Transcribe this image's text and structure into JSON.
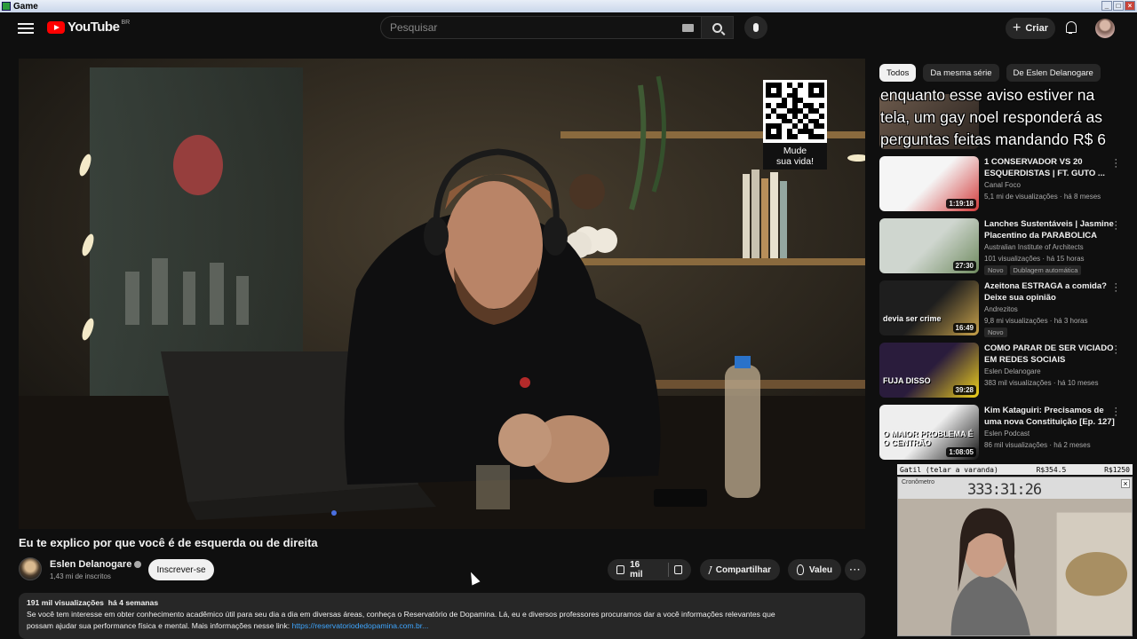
{
  "window": {
    "title": "Game"
  },
  "header": {
    "logo_text": "YouTube",
    "region": "BR",
    "search_placeholder": "Pesquisar",
    "create_label": "Criar"
  },
  "video": {
    "qr_caption_line1": "Mude",
    "qr_caption_line2": "sua vida!",
    "title": "Eu te explico por que você é de esquerda ou de direita",
    "channel_name": "Eslen Delanogare",
    "subscribers": "1,43 mi de inscritos",
    "subscribe_label": "Inscrever-se",
    "likes": "16 mil",
    "share_label": "Compartilhar",
    "thanks_label": "Valeu",
    "views": "191 mil visualizações",
    "age": "há 4 semanas",
    "description_line1": "Se você tem interesse em obter conhecimento acadêmico útil para seu dia a dia em diversas áreas, conheça o Reservatório de Dopamina. Lá, eu e diversos professores procuramos dar a você informações relevantes que",
    "description_line2": "possam ajudar sua performance física e mental. Mais informações nesse link:",
    "description_link": "https://reservatoriodedopamina.com.br..."
  },
  "chips": [
    "Todos",
    "Da mesma série",
    "De Eslen Delanogare"
  ],
  "recommendations": [
    {
      "title": "1 CONSERVADOR VS 20 ESQUERDISTAS | FT. GUTO ...",
      "channel": "Canal Foco",
      "meta": "5,1 mi de visualizações · há 8 meses",
      "duration": "1:19:18",
      "badges": [],
      "thumb_colors": [
        "#f5f5f5",
        "#d23a3a"
      ]
    },
    {
      "title": "Lanches Sustentáveis | Jasmine Placentino da PARABOLICA",
      "channel": "Australian Institute of Architects",
      "meta": "101 visualizações · há 15 horas",
      "duration": "27:30",
      "badges": [
        "Novo",
        "Dublagem automática"
      ],
      "thumb_colors": [
        "#cfd6cf",
        "#6e8a5e"
      ]
    },
    {
      "title": "Azeitona ESTRAGA a comida? Deixe sua opinião",
      "channel": "Andrezitos",
      "meta": "9,8 mi visualizações · há 3 horas",
      "duration": "16:49",
      "badges": [
        "Novo"
      ],
      "thumb_text": "devia ser crime",
      "thumb_colors": [
        "#1e1e1e",
        "#c9a24a"
      ]
    },
    {
      "title": "COMO PARAR DE SER VICIADO EM REDES SOCIAIS",
      "channel": "Eslen Delanogare",
      "meta": "383 mil visualizações · há 10 meses",
      "duration": "39:28",
      "badges": [],
      "thumb_text": "FUJA DISSO",
      "thumb_colors": [
        "#2a1c3c",
        "#f0d21c"
      ]
    },
    {
      "title": "Kim Kataguiri: Precisamos de uma nova Constituição [Ep. 127]",
      "channel": "Eslen Podcast",
      "meta": "86 mil visualizações · há 2 meses",
      "duration": "1:08:05",
      "badges": [],
      "thumb_text": "O MAIOR PROBLEMA É O CENTRÃO",
      "thumb_colors": [
        "#eeeeee",
        "#111111"
      ]
    }
  ],
  "chat_overlay": {
    "lines": [
      "enquanto esse aviso estiver na",
      "tela, um gay noel responderá as",
      "perguntas feitas mandando R$ 6"
    ]
  },
  "stream_overlay": {
    "goal_label": "Gatil (telar a varanda)",
    "goal_current": "R$354.5",
    "goal_target": "R$1250",
    "timer_label": "Cronômetro",
    "timer": "333:31:26"
  }
}
